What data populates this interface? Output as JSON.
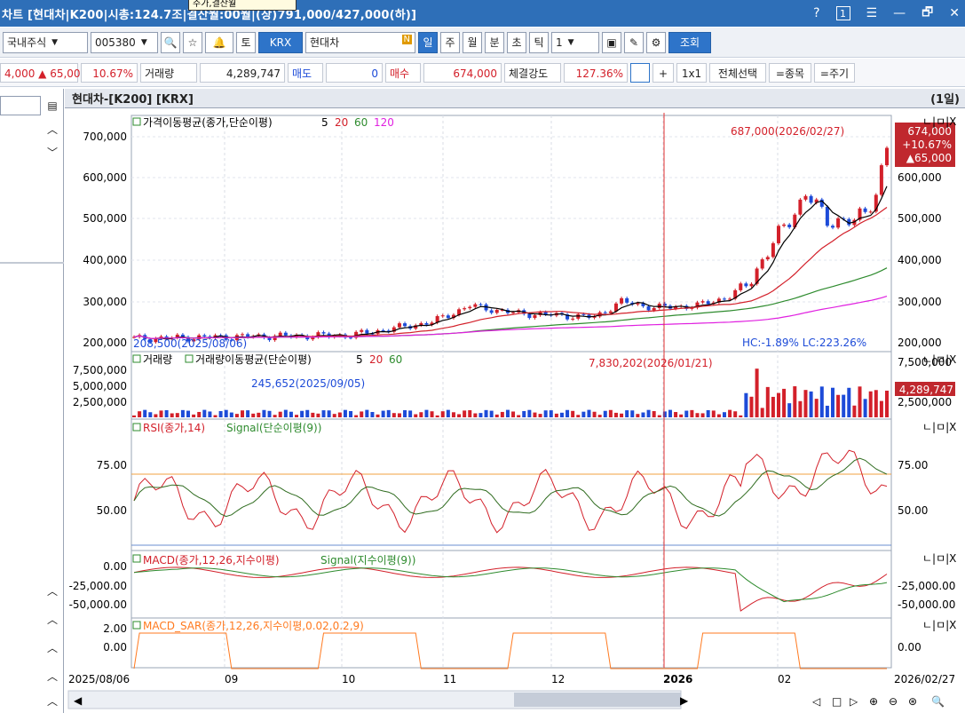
{
  "titlebar": {
    "title": "차트 [현대차|K200|시총:124.7조|결산월:00월|(상)791,000/427,000(하)]",
    "tooltip": "주가,결산월",
    "help": "?",
    "one": "1",
    "menu": "☰",
    "minimize": "—",
    "restore": "🗗",
    "close": "✕"
  },
  "toolbar": {
    "market": "국내주식",
    "code": "005380",
    "search": "🔍",
    "star": "☆",
    "alarm": "🔔",
    "to_label": "토",
    "exchange": "KRX",
    "name": "현대차",
    "badge": "N",
    "periods": [
      "일",
      "주",
      "월",
      "분",
      "초",
      "틱"
    ],
    "selected_period": "일",
    "count": "1",
    "query": "조회"
  },
  "quote": {
    "price_change": "4,000 ▲ 65,000",
    "percent": "10.67%",
    "volume_label": "거래량",
    "volume": "4,289,747",
    "sell_label": "매도",
    "sell": "0",
    "buy_label": "매수",
    "buy": "674,000",
    "strength_label": "체결강도",
    "strength": "127.36%",
    "plus": "+",
    "one_by_one": "1x1",
    "select_all": "전체선택",
    "by_item": "=종목",
    "by_period": "=주기"
  },
  "chart_header": {
    "title": "현대차-[K200] [KRX]",
    "period": "(1일)"
  },
  "price_panel": {
    "legend_prefix": "가격이동평균(종가,단순이평)",
    "ma": [
      "5",
      "20",
      "60",
      "120"
    ],
    "ma_colors": [
      "#000000",
      "#d3202a",
      "#2e8b2e",
      "#e020e0"
    ],
    "yticks": [
      "700,000",
      "600,000",
      "500,000",
      "400,000",
      "300,000",
      "200,000"
    ],
    "high_note": "687,000(2026/02/27)",
    "low_note": "208,500(2025/08/06)",
    "hc_lc": "HC:-1.89%  LC:223.26%",
    "last_price": "674,000",
    "last_pct": "+10.67%",
    "last_chg": "▲65,000"
  },
  "volume_panel": {
    "legend_a": "거래량",
    "legend_b": "거래량이동평균(단순이평)",
    "ma": [
      "5",
      "20",
      "60"
    ],
    "yticks": [
      "7,500,000",
      "5,000,000",
      "2,500,000"
    ],
    "max_note": "7,830,202(2026/01/21)",
    "min_note": "245,652(2025/09/05)",
    "last": "4,289,747"
  },
  "rsi_panel": {
    "legend_a": "RSI(종가,14)",
    "legend_b": "Signal(단순이평(9))",
    "yticks": [
      "75.00",
      "50.00"
    ]
  },
  "macd_panel": {
    "legend_a": "MACD(종가,12,26,지수이평)",
    "legend_b": "Signal(지수이평(9))",
    "yticks": [
      "0.00",
      "-25,000.00",
      "-50,000.00"
    ]
  },
  "sar_panel": {
    "legend": "MACD_SAR(종가,12,26,지수이평,0.02,0.2,9)",
    "yticks": [
      "2.00",
      "0.00"
    ]
  },
  "xaxis": {
    "labels": [
      "2025/08/06",
      "09",
      "10",
      "11",
      "12",
      "2026",
      "02",
      "2026/02/27"
    ]
  },
  "panel_controls": "ㄴ|ㅁ|X",
  "chart_data": {
    "type": "line",
    "title": "현대차-[K200] [KRX]",
    "x": [
      "2025/08/06",
      "2025/09",
      "2025/10",
      "2025/11",
      "2025/12",
      "2026/01",
      "2026/02",
      "2026/02/27"
    ],
    "series": [
      {
        "name": "가격이동평균 5",
        "values": [
          210000,
          220000,
          235000,
          280000,
          290000,
          320000,
          510000,
          560000
        ]
      },
      {
        "name": "가격이동평균 20",
        "values": [
          212000,
          215000,
          225000,
          260000,
          275000,
          290000,
          470000,
          510000
        ]
      },
      {
        "name": "가격이동평균 60",
        "values": [
          210000,
          212000,
          218000,
          235000,
          255000,
          270000,
          360000,
          400000
        ]
      },
      {
        "name": "가격이동평균 120",
        "values": [
          205000,
          207000,
          210000,
          220000,
          235000,
          250000,
          295000,
          320000
        ]
      }
    ],
    "ylim": [
      200000,
      700000
    ],
    "high": {
      "value": 687000,
      "date": "2026/02/27"
    },
    "low": {
      "value": 208500,
      "date": "2025/08/06"
    }
  }
}
